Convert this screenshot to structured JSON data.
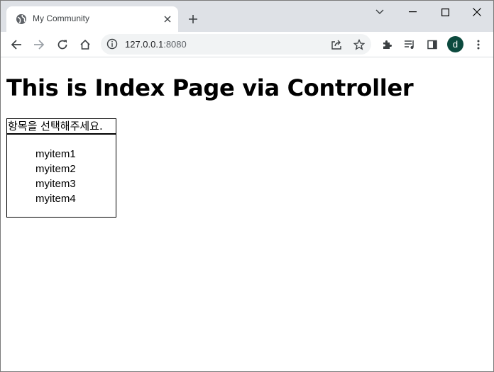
{
  "browser": {
    "tab_title": "My Community",
    "url_host": "127.0.0.1",
    "url_port": ":8080",
    "profile_initial": "d"
  },
  "page": {
    "heading": "This is Index Page via Controller",
    "menu_title": "항목을 선택해주세요.",
    "items": [
      "myitem1",
      "myitem2",
      "myitem3",
      "myitem4"
    ]
  },
  "colors": {
    "tabstrip": "#dee1e6",
    "avatar": "#0c4a3e"
  }
}
